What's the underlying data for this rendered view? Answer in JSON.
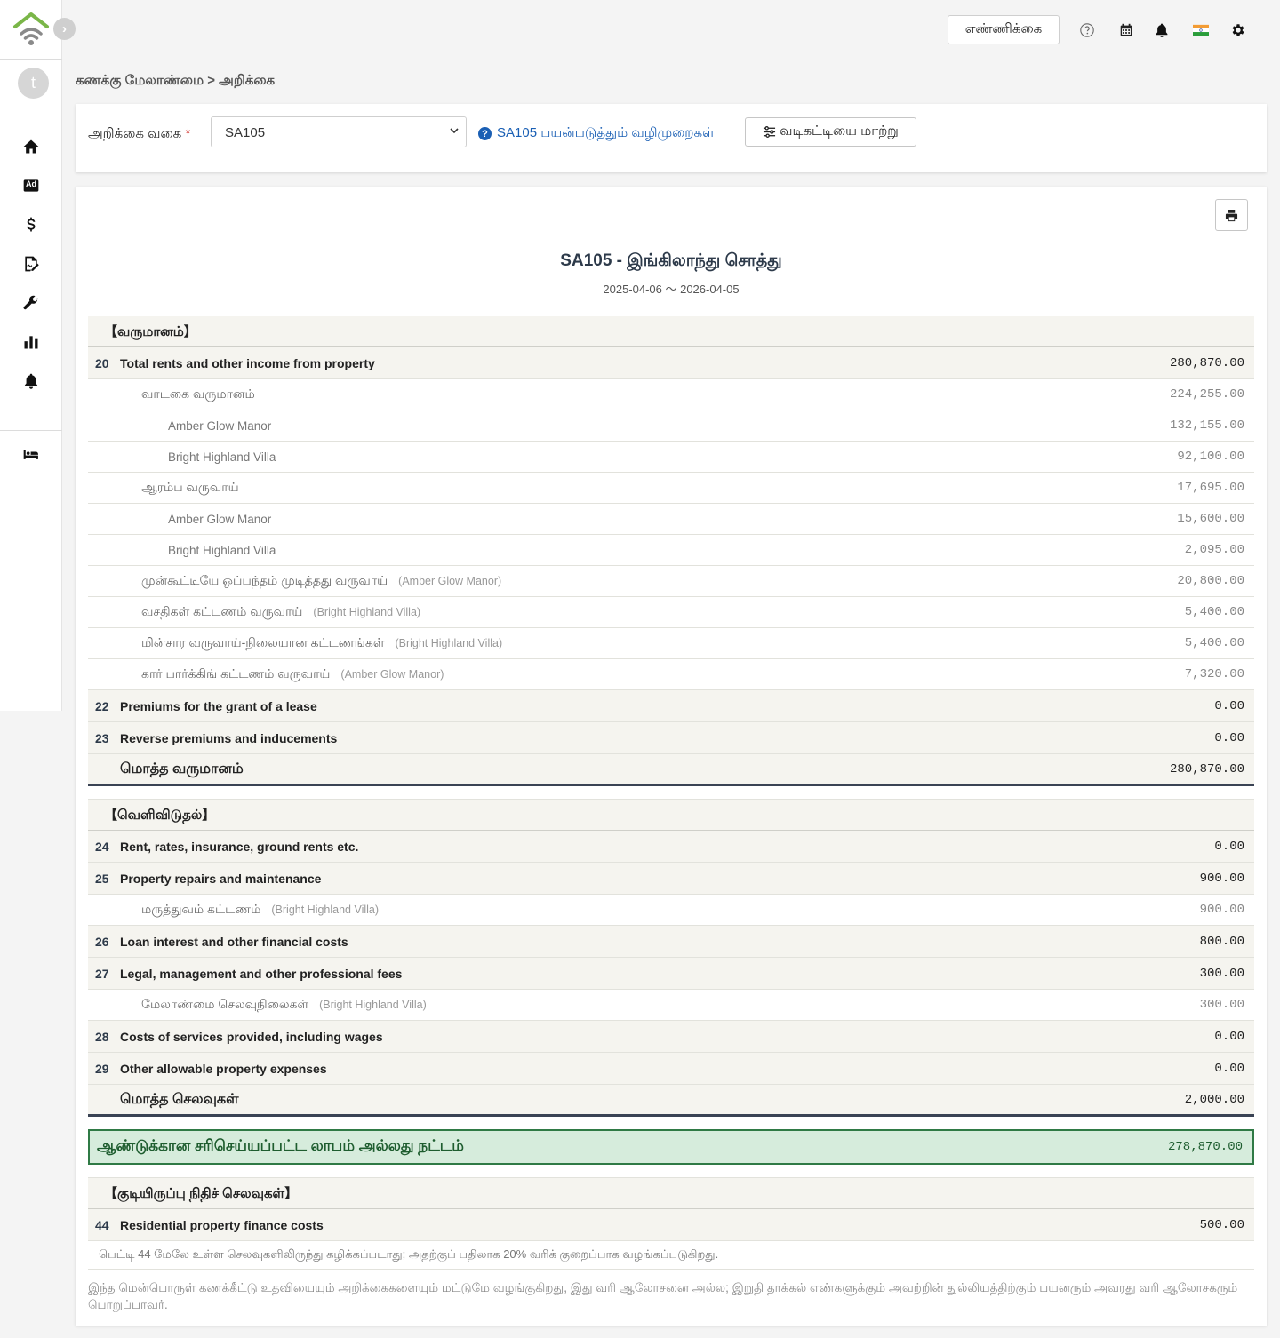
{
  "sidebar": {
    "avatar_initial": "t",
    "toggle_glyph": "›",
    "nav": [
      "home-icon",
      "ad-icon",
      "dollar-icon",
      "contract-icon",
      "wrench-icon",
      "chart-icon",
      "bell-icon",
      "bed-icon"
    ],
    "ad_label": "Ad"
  },
  "header": {
    "count_button": "எண்ணிக்கை",
    "icons": [
      "help-icon",
      "calendar-icon",
      "bell-icon",
      "india-flag-icon",
      "gear-icon"
    ]
  },
  "breadcrumb": {
    "parent": "கணக்கு மேலாண்மை",
    "separator": ">",
    "current": "அறிக்கை"
  },
  "filter": {
    "label": "அறிக்கை வகை",
    "required_mark": "*",
    "selected": "SA105",
    "guide_link": "SA105 பயன்படுத்தும் வழிமுறைகள்",
    "template_button": "வடிகட்டியை மாற்று"
  },
  "report": {
    "title": "SA105 - இங்கிலாந்து சொத்து",
    "period": "2025-04-06 〜 2026-04-05",
    "income_header": "【வருமானம்】",
    "box20": {
      "num": "20",
      "label": "Total rents and other income from property",
      "amount": "280,870.00"
    },
    "rent_income": {
      "label": "வாடகை வருமானம்",
      "amount": "224,255.00"
    },
    "rent_amber": {
      "label": "Amber Glow Manor",
      "amount": "132,155.00"
    },
    "rent_bright": {
      "label": "Bright Highland Villa",
      "amount": "92,100.00"
    },
    "initial_income": {
      "label": "ஆரம்ப வருவாய்",
      "amount": "17,695.00"
    },
    "initial_amber": {
      "label": "Amber Glow Manor",
      "amount": "15,600.00"
    },
    "initial_bright": {
      "label": "Bright Highland Villa",
      "amount": "2,095.00"
    },
    "early_termination": {
      "label": "முன்கூட்டியே ஒப்பந்தம் முடித்தது வருவாய்",
      "prop": "(Amber Glow Manor)",
      "amount": "20,800.00"
    },
    "facility_fee": {
      "label": "வசதிகள் கட்டணம் வருவாய்",
      "prop": "(Bright Highland Villa)",
      "amount": "5,400.00"
    },
    "electricity_fixed": {
      "label": "மின்சார வருவாய்-நிலையான கட்டணங்கள்",
      "prop": "(Bright Highland Villa)",
      "amount": "5,400.00"
    },
    "car_parking": {
      "label": "கார் பார்க்கிங் கட்டணம் வருவாய்",
      "prop": "(Amber Glow Manor)",
      "amount": "7,320.00"
    },
    "box22": {
      "num": "22",
      "label": "Premiums for the grant of a lease",
      "amount": "0.00"
    },
    "box23": {
      "num": "23",
      "label": "Reverse premiums and inducements",
      "amount": "0.00"
    },
    "total_income": {
      "label": "மொத்த வருமானம்",
      "amount": "280,870.00"
    },
    "expense_header": "【வெளிவிடுதல்】",
    "box24": {
      "num": "24",
      "label": "Rent, rates, insurance, ground rents etc.",
      "amount": "0.00"
    },
    "box25": {
      "num": "25",
      "label": "Property repairs and maintenance",
      "amount": "900.00"
    },
    "medical_fee": {
      "label": "மருத்துவம் கட்டணம்",
      "prop": "(Bright Highland Villa)",
      "amount": "900.00"
    },
    "box26": {
      "num": "26",
      "label": "Loan interest and other financial costs",
      "amount": "800.00"
    },
    "box27": {
      "num": "27",
      "label": "Legal, management and other professional fees",
      "amount": "300.00"
    },
    "management_fee": {
      "label": "மேலாண்மை செலவுநிலைகள்",
      "prop": "(Bright Highland Villa)",
      "amount": "300.00"
    },
    "box28": {
      "num": "28",
      "label": "Costs of services provided, including wages",
      "amount": "0.00"
    },
    "box29": {
      "num": "29",
      "label": "Other allowable property expenses",
      "amount": "0.00"
    },
    "total_expenses": {
      "label": "மொத்த செலவுகள்",
      "amount": "2,000.00"
    },
    "profit": {
      "label": "ஆண்டுக்கான சரிசெய்யப்பட்ட லாபம் அல்லது நட்டம்",
      "amount": "278,870.00"
    },
    "finance_header": "【குடியிருப்பு நிதிச் செலவுகள்】",
    "box44": {
      "num": "44",
      "label": "Residential property finance costs",
      "amount": "500.00"
    },
    "box44_note": "பெட்டி 44 மேலே உள்ள செலவுகளிலிருந்து கழிக்கப்படாது; அதற்குப் பதிலாக 20% வரிக் குறைப்பாக வழங்கப்படுகிறது.",
    "disclaimer": "இந்த மென்பொருள் கணக்கீட்டு உதவியையும் அறிக்கைகளையும் மட்டுமே வழங்குகிறது, இது வரி ஆலோசனை அல்ல; இறுதி தாக்கல் எண்களுக்கும் அவற்றின் துல்லியத்திற்கும் பயனரும் அவரது வரி ஆலோசகரும் பொறுப்பாவர்."
  }
}
